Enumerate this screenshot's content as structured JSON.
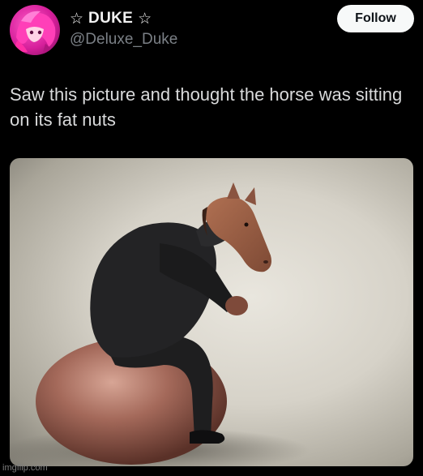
{
  "user": {
    "display_name": "DUKE",
    "star_left": "☆",
    "star_right": "☆",
    "handle": "@Deluxe_Duke",
    "avatar_icon": "pink-anime-character-avatar"
  },
  "follow_button": {
    "label": "Follow"
  },
  "tweet": {
    "text": "Saw this picture and thought the horse was sitting on its fat nuts"
  },
  "media": {
    "description_icon": "horse-headed-man-on-exercise-ball-image"
  },
  "watermark": {
    "text": "imgflip.com"
  },
  "colors": {
    "background": "#000000",
    "text": "#d9dadb",
    "handle": "#7b8086",
    "follow_bg": "#f7f9f9",
    "avatar_pink": "#d61f9b"
  }
}
